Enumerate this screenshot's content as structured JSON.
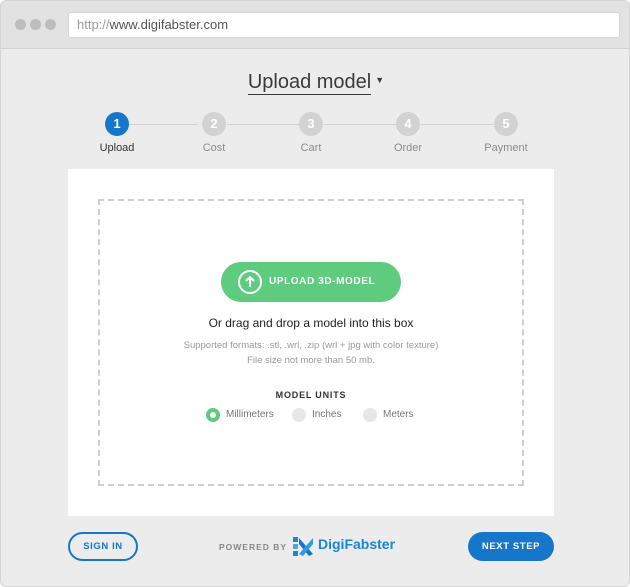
{
  "browser": {
    "url_protocol": "http://",
    "url_host": "www.digifabster.com"
  },
  "page": {
    "title": "Upload model"
  },
  "steps": [
    {
      "number": "1",
      "label": "Upload",
      "active": true
    },
    {
      "number": "2",
      "label": "Cost",
      "active": false
    },
    {
      "number": "3",
      "label": "Cart",
      "active": false
    },
    {
      "number": "4",
      "label": "Order",
      "active": false
    },
    {
      "number": "5",
      "label": "Payment",
      "active": false
    }
  ],
  "upload": {
    "button_label": "UPLOAD 3D-MODEL",
    "drag_text": "Or drag and drop a model into this box",
    "formats_line1": "Supported formats: .stl, .wrl, .zip (wrl + jpg with color texture)",
    "formats_line2": "File size not more than 50 mb."
  },
  "units": {
    "title": "MODEL UNITS",
    "options": [
      {
        "label": "Millimeters",
        "selected": true
      },
      {
        "label": "Inches",
        "selected": false
      },
      {
        "label": "Meters",
        "selected": false
      }
    ]
  },
  "footer": {
    "signin_label": "SIGN IN",
    "powered_by": "POWERED BY",
    "brand": "DigiFabster",
    "next_label": "NEXT STEP"
  },
  "colors": {
    "primary_blue": "#1676c9",
    "green": "#5ecb7e",
    "brand_blue": "#1a86d8"
  }
}
